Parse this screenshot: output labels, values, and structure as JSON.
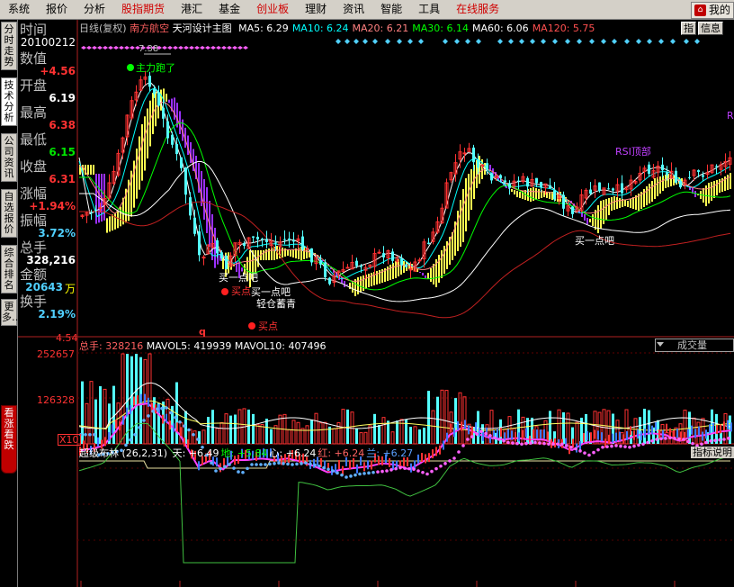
{
  "menu": [
    "系统",
    "报价",
    "分析",
    "股指期货",
    "港汇",
    "基金",
    "创业板",
    "理财",
    "资讯",
    "智能",
    "工具",
    "在线服务"
  ],
  "menu_red": [
    false,
    false,
    false,
    true,
    false,
    false,
    true,
    false,
    false,
    false,
    false,
    true
  ],
  "mine_label": "我的",
  "tabs": [
    "分时走势",
    "技术分析",
    "公司资讯",
    "自选报价",
    "综合排名",
    "更多…"
  ],
  "active_tab": "技术分析",
  "red_tab": "看涨看跌",
  "info": {
    "time_label": "时间",
    "date": "20100212",
    "value_label": "数值",
    "value": "+4.56",
    "open_label": "开盘",
    "open": "6.19",
    "high_label": "最高",
    "high": "6.38",
    "low_label": "最低",
    "low": "6.15",
    "close_label": "收盘",
    "close": "6.31",
    "change_label": "涨幅",
    "change": "+1.94%",
    "amplitude_label": "振幅",
    "amplitude": "3.72%",
    "volume_label": "总手",
    "volume": "328,216",
    "amount_label": "金额",
    "amount": "20643",
    "amount_unit": "万",
    "turnover_label": "换手",
    "turnover": "2.19%"
  },
  "price_header": {
    "period": "日线(复权)",
    "stock": "南方航空",
    "template": "天河设计主图",
    "ma": [
      {
        "label": "MA5: 6.29",
        "color": "#ffffff"
      },
      {
        "label": "MA10: 6.24",
        "color": "#00ffff"
      },
      {
        "label": "MA20: 6.21",
        "color": "#ff8080"
      },
      {
        "label": "MA30: 6.14",
        "color": "#00ff00"
      },
      {
        "label": "MA60: 6.06",
        "color": "#ffffff"
      },
      {
        "label": "MA120: 5.75",
        "color": "#ff5050"
      }
    ]
  },
  "buttons": {
    "zhi": "指",
    "info": "信息",
    "indicator": "指标说明"
  },
  "annotations": {
    "main_run": "主力跑了",
    "peak": "7.38",
    "buy1": "买一点吧",
    "buy2": "买一点吧",
    "buy3": "买一点吧",
    "buy_point1": "买点",
    "buy_point2": "买点",
    "leave": "轻仓蓄青",
    "rsi": "RSI顶部",
    "q_mark": "q",
    "right_r": "R"
  },
  "price_axis": {
    "low_label": "4.54"
  },
  "volume": {
    "header_label": "总手: 328216",
    "mavol5": "MAVOL5: 419939",
    "mavol10": "MAVOL10: 407496",
    "axis": [
      "252657",
      "126328",
      "X10"
    ],
    "dropdown": "成交量"
  },
  "indicator": {
    "title": "超级布林 (26,2,31)",
    "values": [
      {
        "label": "天: +6.49",
        "color": "#ffffff"
      },
      {
        "label": "地: +5.84",
        "color": "#00ff00"
      },
      {
        "label": "心: +6.24",
        "color": "#ffffff"
      },
      {
        "label": "红: +6.24",
        "color": "#ff6464"
      },
      {
        "label": "兰: +6.27",
        "color": "#5aa0ff"
      }
    ]
  },
  "colors": {
    "up": "#ff3232",
    "down": "#54ffff",
    "purple": "#9b30ff",
    "yellow": "#ffff50"
  }
}
